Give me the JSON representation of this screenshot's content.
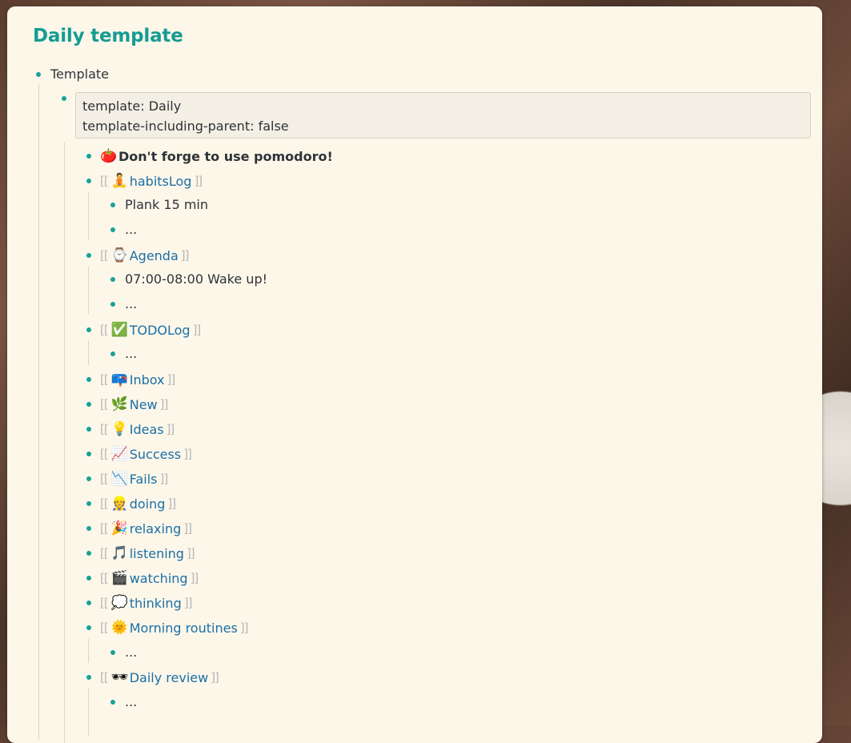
{
  "page": {
    "title": "Daily template"
  },
  "root": {
    "label": "Template"
  },
  "properties": {
    "template": "template: Daily",
    "template_including_parent": "template-including-parent: false"
  },
  "reminder": {
    "icon": "tomato-icon",
    "text": "Don't forge to use pomodoro!"
  },
  "brackets": {
    "open": "[[",
    "close": "]]"
  },
  "items": [
    {
      "label": "habitsLog",
      "icon": "yoga-person-icon",
      "glyph": "🧘"
    },
    {
      "label": "Plank 15 min"
    },
    {
      "label": "..."
    },
    {
      "label": "Agenda",
      "icon": "watch-icon",
      "glyph": "⌚"
    },
    {
      "label": "07:00-08:00 Wake up!"
    },
    {
      "label": "..."
    },
    {
      "label": "TODOLog",
      "icon": "check-mark-button-icon",
      "glyph": "✅"
    },
    {
      "label": "..."
    },
    {
      "label": "Inbox",
      "icon": "mailbox-icon",
      "glyph": "📪"
    },
    {
      "label": "New",
      "icon": "herb-icon",
      "glyph": "🌿"
    },
    {
      "label": "Ideas",
      "icon": "light-bulb-icon",
      "glyph": "💡"
    },
    {
      "label": "Success",
      "icon": "chart-increasing-icon",
      "glyph": "📈"
    },
    {
      "label": "Fails",
      "icon": "chart-decreasing-icon",
      "glyph": "📉"
    },
    {
      "label": "doing",
      "icon": "worker-icon",
      "glyph": "👷"
    },
    {
      "label": "relaxing",
      "icon": "party-popper-icon",
      "glyph": "🎉"
    },
    {
      "label": "listening",
      "icon": "musical-notes-icon",
      "glyph": "🎵"
    },
    {
      "label": "watching",
      "icon": "clapper-board-icon",
      "glyph": "🎬"
    },
    {
      "label": "thinking",
      "icon": "speech-balloon-icon",
      "glyph": "💭"
    },
    {
      "label": "Morning routines",
      "icon": "sun-icon",
      "glyph": "🌞"
    },
    {
      "label": "..."
    },
    {
      "label": "Daily review",
      "icon": "sunglasses-icon",
      "glyph": "🕶"
    },
    {
      "label": "..."
    }
  ]
}
